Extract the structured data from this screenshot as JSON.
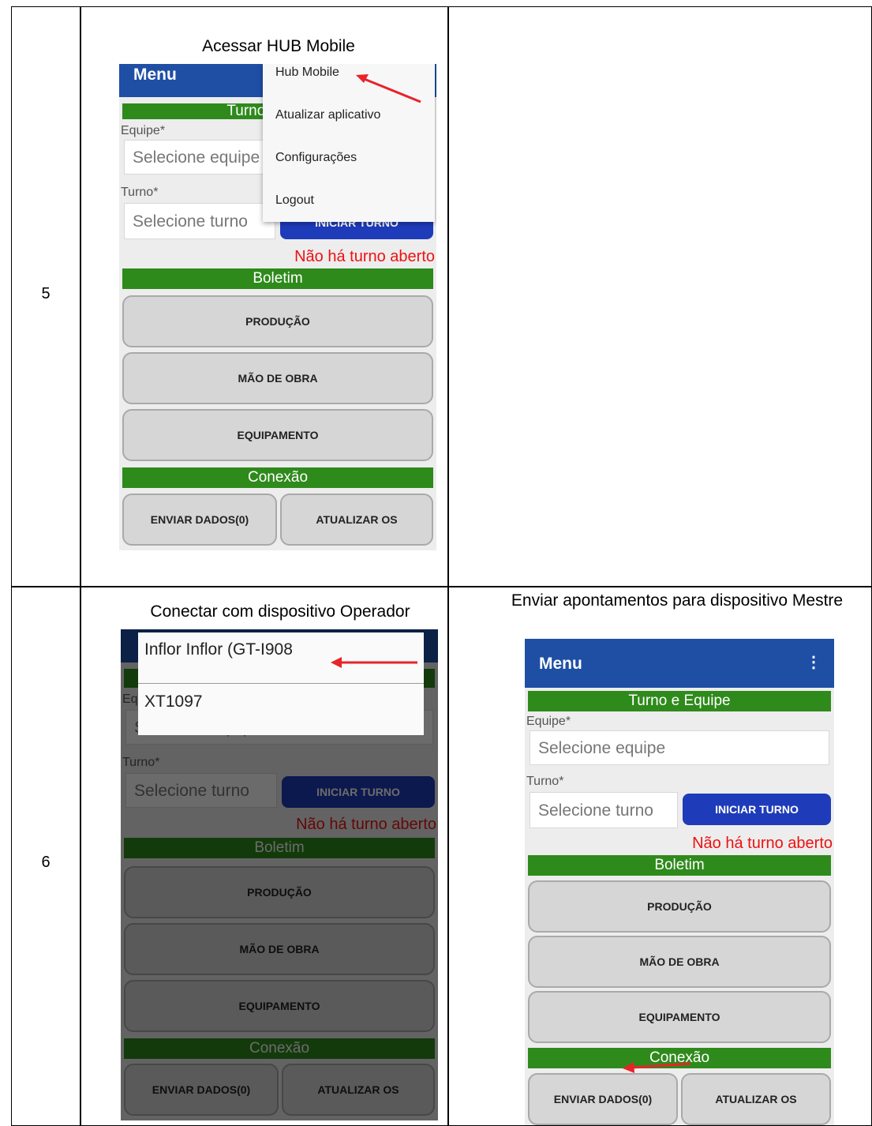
{
  "steps": [
    {
      "number": "5",
      "left_caption": "Acessar HUB Mobile",
      "right_caption": ""
    },
    {
      "number": "6",
      "left_caption": "Conectar com dispositivo Operador",
      "right_caption": "Enviar apontamentos para dispositivo Mestre"
    }
  ],
  "app": {
    "menu_title": "Menu",
    "section_turno": "Turno e Equipe",
    "equipe_label": "Equipe*",
    "equipe_placeholder": "Selecione equipe",
    "turno_label": "Turno*",
    "turno_placeholder": "Selecione turno",
    "iniciar_button": "INICIAR TURNO",
    "no_shift_message": "Não há turno aberto",
    "section_boletim": "Boletim",
    "producao_button": "PRODUÇÃO",
    "mao_obra_button": "MÃO DE OBRA",
    "equipamento_button": "EQUIPAMENTO",
    "section_conexao": "Conexão",
    "enviar_button": "ENVIAR DADOS(0)",
    "atualizar_os_button": "ATUALIZAR OS"
  },
  "overflow_menu": {
    "items": [
      "Hub Mobile",
      "Atualizar aplicativo",
      "Configurações",
      "Logout"
    ]
  },
  "device_dialog": {
    "items": [
      "Inflor Inflor (GT-I908",
      "XT1097"
    ]
  },
  "colors": {
    "app_bar": "#1e4fa5",
    "section_green": "#2f8a1c",
    "primary_button": "#1e3cba",
    "warning_red": "#e11111",
    "annotation_arrow": "#e8232a"
  }
}
